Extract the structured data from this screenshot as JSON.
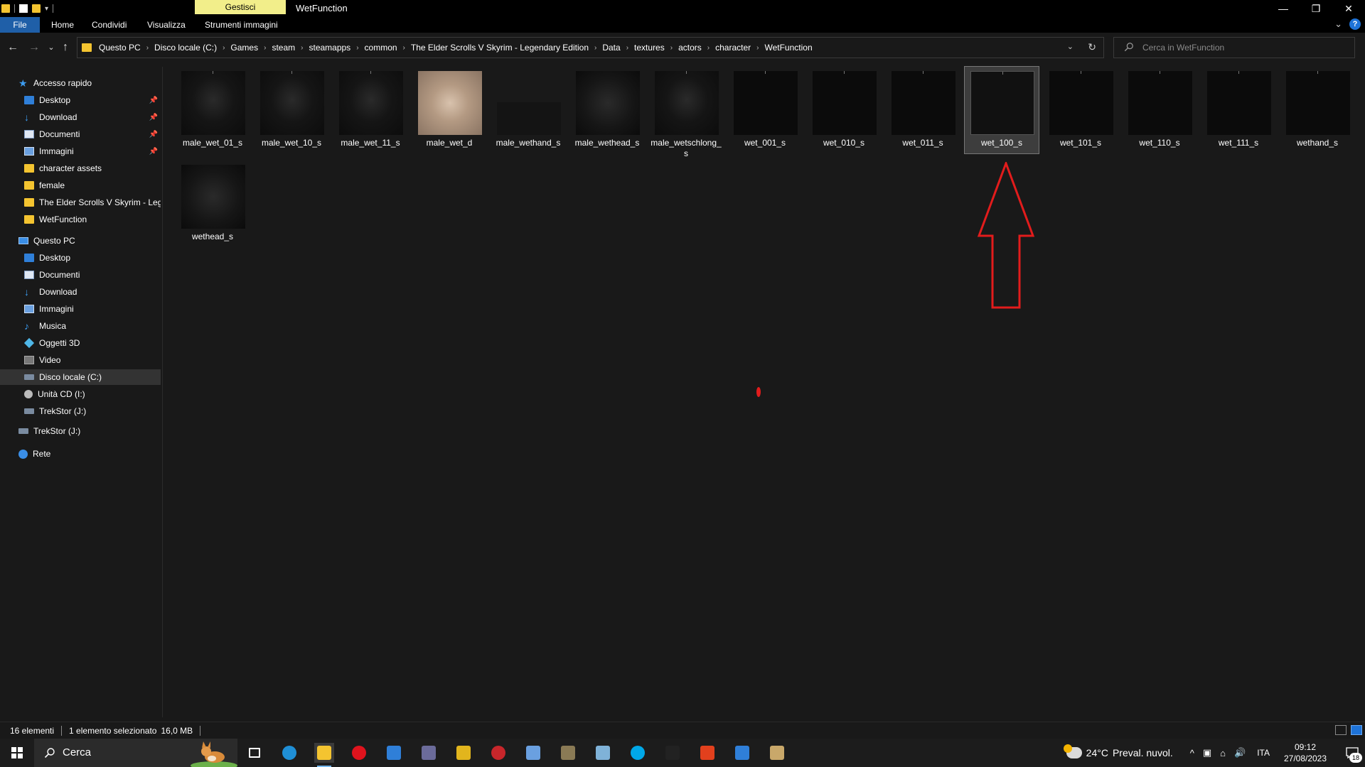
{
  "titlebar": {
    "context_tab": "Gestisci",
    "window_title": "WetFunction",
    "controls": {
      "minimize": "—",
      "restore": "❐",
      "close": "✕"
    }
  },
  "ribbon": {
    "tabs": [
      "File",
      "Home",
      "Condividi",
      "Visualizza",
      "Strumenti immagini"
    ],
    "expand_glyph": "⌄",
    "help_glyph": "?"
  },
  "nav_buttons": {
    "back": "←",
    "forward": "→",
    "recent": "⌄",
    "up": "↑"
  },
  "address": {
    "breadcrumbs": [
      "Questo PC",
      "Disco locale (C:)",
      "Games",
      "steam",
      "steamapps",
      "common",
      "The Elder Scrolls V Skyrim - Legendary Edition",
      "Data",
      "textures",
      "actors",
      "character",
      "WetFunction"
    ],
    "separator": "›",
    "dropdown_glyph": "⌄",
    "refresh_glyph": "↻"
  },
  "search": {
    "placeholder": "Cerca in WetFunction"
  },
  "nav_pane": {
    "quick_access": {
      "label": "Accesso rapido",
      "items": [
        {
          "label": "Desktop",
          "icon": "desktop-icon",
          "pinned": true
        },
        {
          "label": "Download",
          "icon": "download-icon",
          "pinned": true
        },
        {
          "label": "Documenti",
          "icon": "documents-icon",
          "pinned": true
        },
        {
          "label": "Immagini",
          "icon": "pictures-icon",
          "pinned": true
        },
        {
          "label": "character assets",
          "icon": "folder-icon",
          "pinned": false
        },
        {
          "label": "female",
          "icon": "folder-icon",
          "pinned": false
        },
        {
          "label": "The Elder Scrolls V Skyrim - Leger",
          "icon": "folder-icon",
          "pinned": false
        },
        {
          "label": "WetFunction",
          "icon": "folder-icon",
          "pinned": false
        }
      ]
    },
    "this_pc": {
      "label": "Questo PC",
      "items": [
        {
          "label": "Desktop",
          "icon": "desktop-icon"
        },
        {
          "label": "Documenti",
          "icon": "documents-icon"
        },
        {
          "label": "Download",
          "icon": "download-icon"
        },
        {
          "label": "Immagini",
          "icon": "pictures-icon"
        },
        {
          "label": "Musica",
          "icon": "music-icon"
        },
        {
          "label": "Oggetti 3D",
          "icon": "3d-objects-icon"
        },
        {
          "label": "Video",
          "icon": "video-icon"
        },
        {
          "label": "Disco locale (C:)",
          "icon": "drive-icon",
          "selected": true
        },
        {
          "label": "Unità CD (I:)",
          "icon": "cd-drive-icon"
        },
        {
          "label": "TrekStor (J:)",
          "icon": "usb-drive-icon"
        }
      ]
    },
    "trekstor": "TrekStor (J:)",
    "network": "Rete",
    "pin_glyph": "📌"
  },
  "files": [
    {
      "name": "male_wet_01_s",
      "thumb": "dark"
    },
    {
      "name": "male_wet_10_s",
      "thumb": "dark"
    },
    {
      "name": "male_wet_11_s",
      "thumb": "dark"
    },
    {
      "name": "male_wet_d",
      "thumb": "body"
    },
    {
      "name": "male_wethand_s",
      "thumb": "wide"
    },
    {
      "name": "male_wethead_s",
      "thumb": "face"
    },
    {
      "name": "male_wetschlong_s",
      "thumb": "dark"
    },
    {
      "name": "wet_001_s",
      "thumb": "black"
    },
    {
      "name": "wet_010_s",
      "thumb": "black"
    },
    {
      "name": "wet_011_s",
      "thumb": "black"
    },
    {
      "name": "wet_100_s",
      "thumb": "black",
      "selected": true
    },
    {
      "name": "wet_101_s",
      "thumb": "black"
    },
    {
      "name": "wet_110_s",
      "thumb": "black"
    },
    {
      "name": "wet_111_s",
      "thumb": "black"
    },
    {
      "name": "wethand_s",
      "thumb": "black"
    },
    {
      "name": "wethead_s",
      "thumb": "face"
    }
  ],
  "annotation": {
    "arrow_color": "#e21c1c"
  },
  "statusbar": {
    "count": "16 elementi",
    "selection": "1 elemento selezionato",
    "size": "16,0 MB"
  },
  "taskbar": {
    "search_label": "Cerca",
    "apps": [
      {
        "name": "task-view",
        "color": "#1c1c1c"
      },
      {
        "name": "edge",
        "color": "#1f8fd6"
      },
      {
        "name": "file-explorer",
        "color": "#f4c430",
        "active": true
      },
      {
        "name": "opera",
        "color": "#e0131d"
      },
      {
        "name": "store",
        "color": "#2f7fd8"
      },
      {
        "name": "app-gallery",
        "color": "#6b6b9a"
      },
      {
        "name": "app-yellow",
        "color": "#e2b51d"
      },
      {
        "name": "app-red-circle",
        "color": "#c8262b"
      },
      {
        "name": "app-pen",
        "color": "#6aa0e0"
      },
      {
        "name": "app-dark-logo",
        "color": "#8a7a55"
      },
      {
        "name": "app-paint",
        "color": "#7fb2d8"
      },
      {
        "name": "skype",
        "color": "#00a8e8"
      },
      {
        "name": "app-msi",
        "color": "#222222"
      },
      {
        "name": "app-f",
        "color": "#e2401d"
      },
      {
        "name": "app-window",
        "color": "#2f7fd8"
      },
      {
        "name": "app-arrow",
        "color": "#c9a86a"
      }
    ],
    "weather": {
      "temp": "24°C",
      "desc": "Preval. nuvol."
    },
    "tray_glyphs": [
      "^",
      "▣",
      "⌂",
      "🔊"
    ],
    "language": "ITA",
    "time": "09:12",
    "date": "27/08/2023",
    "notif_count": "18"
  }
}
